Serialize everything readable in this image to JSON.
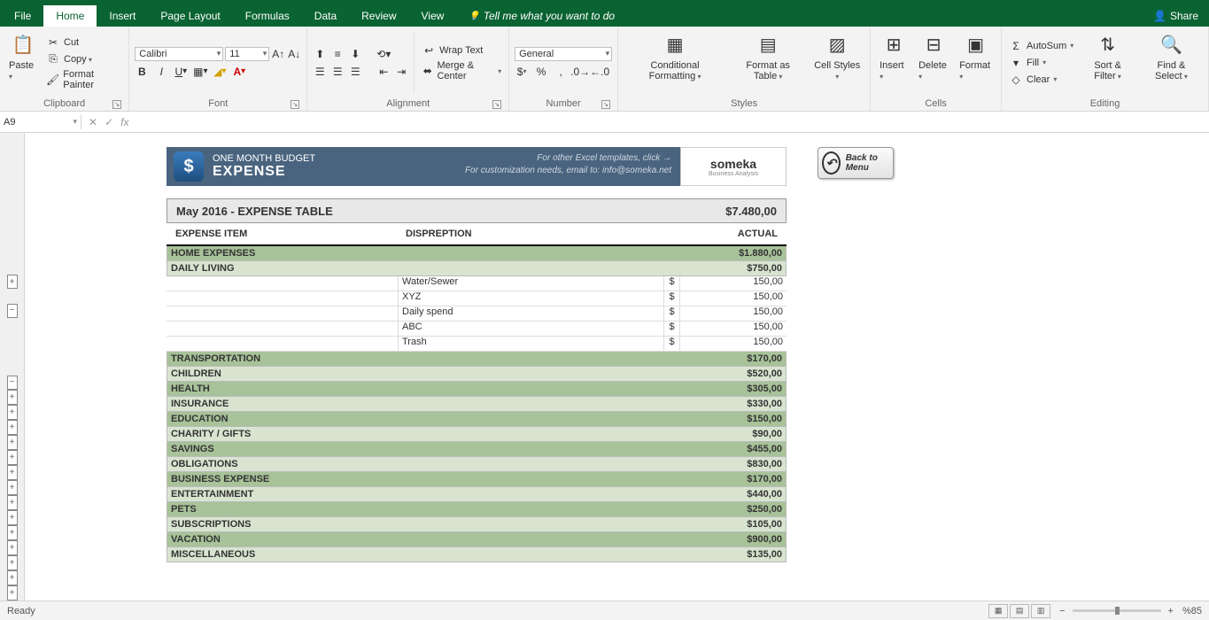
{
  "tabs": {
    "file": "File",
    "home": "Home",
    "insert": "Insert",
    "pagelayout": "Page Layout",
    "formulas": "Formulas",
    "data": "Data",
    "review": "Review",
    "view": "View",
    "tell": "Tell me what you want to do"
  },
  "share": "Share",
  "ribbon": {
    "clipboard": {
      "paste": "Paste",
      "cut": "Cut",
      "copy": "Copy",
      "formatpainter": "Format Painter",
      "label": "Clipboard"
    },
    "font": {
      "name": "Calibri",
      "size": "11",
      "label": "Font"
    },
    "alignment": {
      "wrap": "Wrap Text",
      "merge": "Merge & Center",
      "label": "Alignment"
    },
    "number": {
      "format": "General",
      "label": "Number"
    },
    "styles": {
      "cond": "Conditional Formatting",
      "table": "Format as Table",
      "cell": "Cell Styles",
      "label": "Styles"
    },
    "cells": {
      "insert": "Insert",
      "delete": "Delete",
      "format": "Format",
      "label": "Cells"
    },
    "editing": {
      "autosum": "AutoSum",
      "fill": "Fill",
      "clear": "Clear",
      "sort": "Sort & Filter",
      "find": "Find & Select",
      "label": "Editing"
    }
  },
  "namebox": "A9",
  "sheet": {
    "header": {
      "title1": "ONE MONTH BUDGET",
      "title2": "EXPENSE",
      "note1": "For other Excel templates, click →",
      "note2": "For customization needs, email to: info@someka.net",
      "brand": "someka",
      "brandtag": "Business Analysis"
    },
    "backbtn": "Back to Menu",
    "tabletitle": "May 2016 - EXPENSE TABLE",
    "tabletotal": "$7.480,00",
    "cols": {
      "item": "EXPENSE ITEM",
      "desc": "DISPREPTION",
      "actual": "ACTUAL"
    },
    "categories": [
      {
        "name": "HOME EXPENSES",
        "value": "$1.880,00",
        "shade": "dark"
      },
      {
        "name": "DAILY LIVING",
        "value": "$750,00",
        "shade": "light"
      },
      {
        "name": "TRANSPORTATION",
        "value": "$170,00",
        "shade": "dark"
      },
      {
        "name": "CHILDREN",
        "value": "$520,00",
        "shade": "light"
      },
      {
        "name": "HEALTH",
        "value": "$305,00",
        "shade": "dark"
      },
      {
        "name": "INSURANCE",
        "value": "$330,00",
        "shade": "light"
      },
      {
        "name": "EDUCATION",
        "value": "$150,00",
        "shade": "dark"
      },
      {
        "name": "CHARITY / GIFTS",
        "value": "$90,00",
        "shade": "light"
      },
      {
        "name": "SAVINGS",
        "value": "$455,00",
        "shade": "dark"
      },
      {
        "name": "OBLIGATIONS",
        "value": "$830,00",
        "shade": "light"
      },
      {
        "name": "BUSINESS EXPENSE",
        "value": "$170,00",
        "shade": "dark"
      },
      {
        "name": "ENTERTAINMENT",
        "value": "$440,00",
        "shade": "light"
      },
      {
        "name": "PETS",
        "value": "$250,00",
        "shade": "dark"
      },
      {
        "name": "SUBSCRIPTIONS",
        "value": "$105,00",
        "shade": "light"
      },
      {
        "name": "VACATION",
        "value": "$900,00",
        "shade": "dark"
      },
      {
        "name": "MISCELLANEOUS",
        "value": "$135,00",
        "shade": "light"
      }
    ],
    "details": [
      {
        "desc": "Water/Sewer",
        "cur": "$",
        "val": "150,00"
      },
      {
        "desc": "XYZ",
        "cur": "$",
        "val": "150,00"
      },
      {
        "desc": "Daily spend",
        "cur": "$",
        "val": "150,00"
      },
      {
        "desc": "ABC",
        "cur": "$",
        "val": "150,00"
      },
      {
        "desc": "Trash",
        "cur": "$",
        "val": "150,00"
      }
    ]
  },
  "status": {
    "ready": "Ready",
    "zoom": "%85"
  }
}
